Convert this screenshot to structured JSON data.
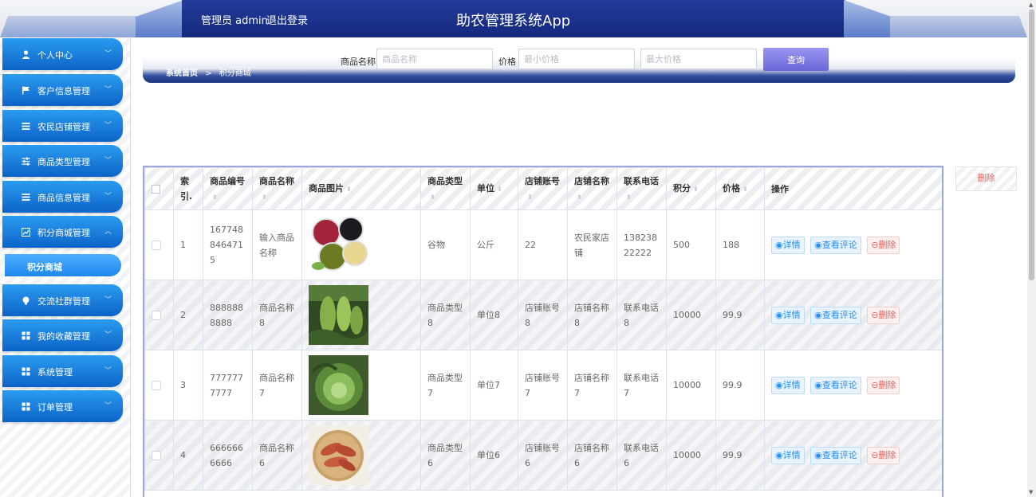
{
  "header": {
    "admin_label": "管理员 admin",
    "logout_label": "退出登录",
    "app_title": "助农管理系统App",
    "colors": {
      "header_blue": "#14287d",
      "menu_blue": "#0d63c8"
    }
  },
  "sidebar": {
    "items": [
      {
        "label": "个人中心",
        "icon": "user-icon"
      },
      {
        "label": "客户信息管理",
        "icon": "flag-icon"
      },
      {
        "label": "农民店铺管理",
        "icon": "list-icon"
      },
      {
        "label": "商品类型管理",
        "icon": "sliders-icon"
      },
      {
        "label": "商品信息管理",
        "icon": "list-icon"
      },
      {
        "label": "积分商城管理",
        "icon": "chart-icon"
      },
      {
        "label": "交流社群管理",
        "icon": "bulb-icon"
      },
      {
        "label": "我的收藏管理",
        "icon": "grid-icon"
      },
      {
        "label": "系统管理",
        "icon": "grid-icon"
      },
      {
        "label": "订单管理",
        "icon": "grid-icon"
      }
    ],
    "active_sub": "积分商城"
  },
  "breadcrumb": {
    "home": "系统首页",
    "separator": ">",
    "current": "积分商城"
  },
  "search": {
    "name_label": "商品名称",
    "name_placeholder": "商品名称",
    "price_label": "价格",
    "min_placeholder": "最小价格",
    "max_placeholder": "最大价格",
    "query_button": "查询"
  },
  "batch_delete_label": "删除",
  "table": {
    "headers": {
      "index": "索引.",
      "code": "商品编号",
      "name": "商品名称",
      "image": "商品图片",
      "type": "商品类型",
      "unit": "单位",
      "account": "店铺账号",
      "shop": "店铺名称",
      "phone": "联系电话",
      "points": "积分",
      "price": "价格",
      "ops": "操作"
    },
    "rows": [
      {
        "index": "1",
        "code": "1677488464715",
        "name": "输入商品名称",
        "image": "grains-bowls",
        "type": "谷物",
        "unit": "公斤",
        "account": "22",
        "shop": "农民家店铺",
        "phone": "13823822222",
        "points": "500",
        "price": "188"
      },
      {
        "index": "2",
        "code": "8888888888",
        "name": "商品名称8",
        "image": "green-bitter-melon",
        "type": "商品类型8",
        "unit": "单位8",
        "account": "店铺账号8",
        "shop": "店铺名称8",
        "phone": "联系电话8",
        "points": "10000",
        "price": "99.9"
      },
      {
        "index": "3",
        "code": "7777777777",
        "name": "商品名称7",
        "image": "cabbage",
        "type": "商品类型7",
        "unit": "单位7",
        "account": "店铺账号7",
        "shop": "店铺名称7",
        "phone": "联系电话7",
        "points": "10000",
        "price": "99.9"
      },
      {
        "index": "4",
        "code": "6666666666",
        "name": "商品名称6",
        "image": "sweet-potatoes",
        "type": "商品类型6",
        "unit": "单位6",
        "account": "店铺账号6",
        "shop": "店铺名称6",
        "phone": "联系电话6",
        "points": "10000",
        "price": "99.9"
      }
    ],
    "ops": {
      "detail": "详情",
      "comment": "查看评论",
      "delete": "删除"
    }
  }
}
